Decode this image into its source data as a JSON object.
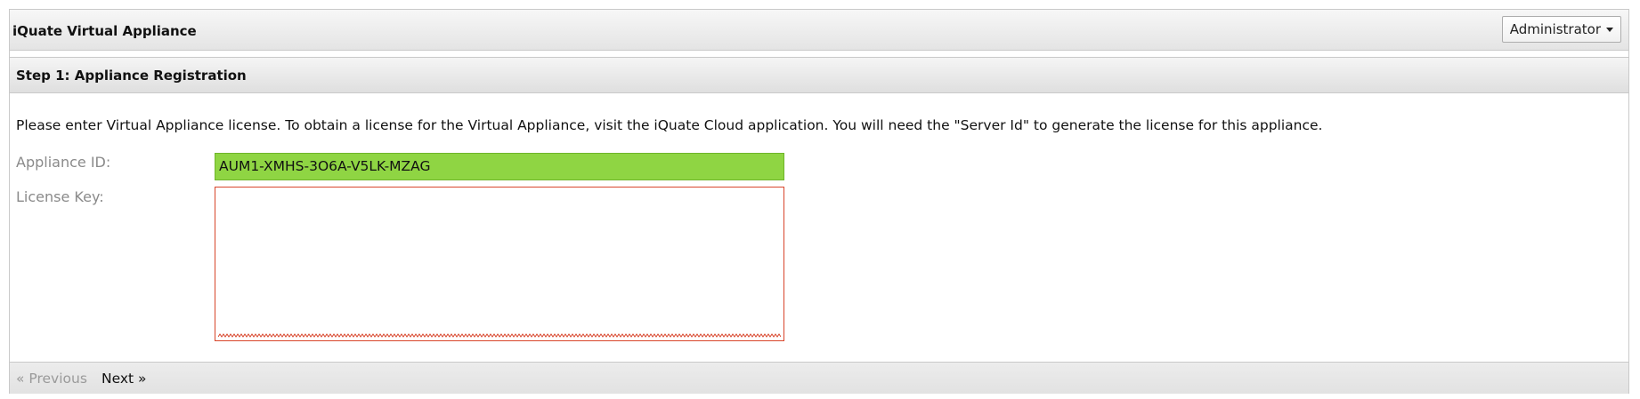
{
  "header": {
    "title": "iQuate Virtual Appliance",
    "user_menu_label": "Administrator"
  },
  "step": {
    "title": "Step 1: Appliance Registration",
    "instructions": "Please enter Virtual Appliance license. To obtain a license for the Virtual Appliance, visit the iQuate Cloud application. You will need the \"Server Id\" to generate the license for this appliance."
  },
  "form": {
    "appliance_id_label": "Appliance ID:",
    "appliance_id_value": "AUM1-XMHS-3O6A-V5LK-MZAG",
    "license_key_label": "License Key:",
    "license_key_value": ""
  },
  "footer": {
    "previous_label": "« Previous",
    "next_label": "Next »"
  },
  "colors": {
    "valid_field": "#8fd543",
    "invalid_border": "#d8452b",
    "disabled_link": "#9a9a9a"
  }
}
